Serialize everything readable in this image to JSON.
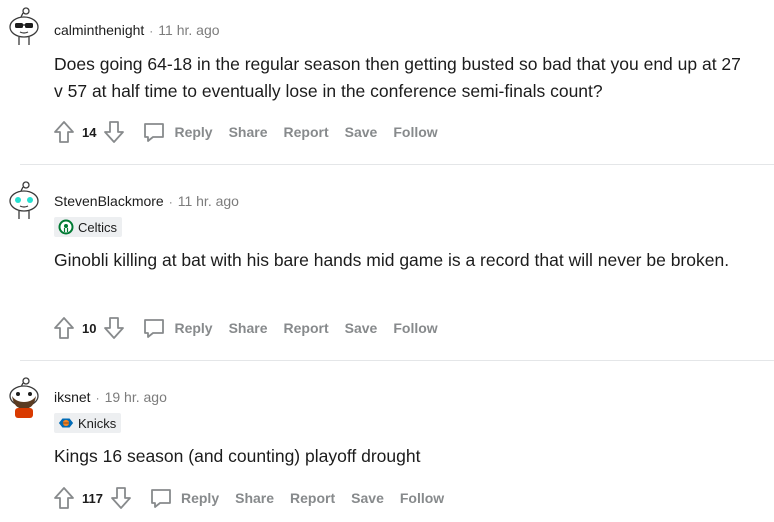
{
  "comments": [
    {
      "username": "calminthenight",
      "time": "11 hr. ago",
      "flair": null,
      "body": "Does going 64-18 in the regular season then getting busted so bad that you end up at 27 v 57 at half time to eventually lose in the conference semi-finals count?",
      "score": "14",
      "actions": {
        "reply": "Reply",
        "share": "Share",
        "report": "Report",
        "save": "Save",
        "follow": "Follow"
      }
    },
    {
      "username": "StevenBlackmore",
      "time": "11 hr. ago",
      "flair": {
        "label": "Celtics",
        "icon": "celtics-logo-icon"
      },
      "body": "Ginobli killing at bat with his bare hands mid game is a record that will never be broken.",
      "score": "10",
      "actions": {
        "reply": "Reply",
        "share": "Share",
        "report": "Report",
        "save": "Save",
        "follow": "Follow"
      }
    },
    {
      "username": "iksnet",
      "time": "19 hr. ago",
      "flair": {
        "label": "Knicks",
        "icon": "knicks-logo-icon"
      },
      "body": "Kings 16 season (and counting) playoff drought",
      "score": "117",
      "actions": {
        "reply": "Reply",
        "share": "Share",
        "report": "Report",
        "save": "Save",
        "follow": "Follow"
      }
    }
  ],
  "colors": {
    "text": "#1c1c1c",
    "meta": "#7c7c7c",
    "action": "#878a8c",
    "flair_bg": "#edeff1",
    "celtics_green": "#007a33",
    "knicks_orange": "#f58426",
    "knicks_blue": "#006bb6",
    "avatar_teal": "#24e0d0"
  }
}
